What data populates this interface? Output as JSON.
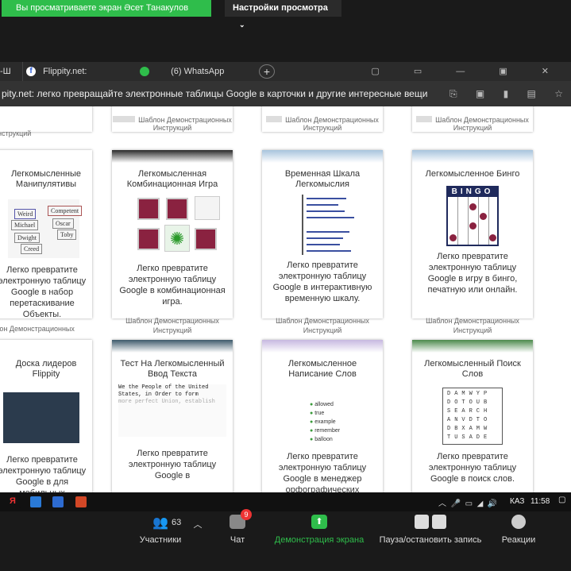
{
  "zoom": {
    "share_banner": "Вы просматриваете экран Әсет Танакулов",
    "view_options": "Настройки просмотра",
    "participants_label": "Участники",
    "participants_count": "63",
    "chat_label": "Чат",
    "chat_badge": "9",
    "share_screen_label": "Демонстрация экрана",
    "pause_record_label": "Пауза/остановить запись",
    "reactions_label": "Реакции"
  },
  "browser": {
    "tabs": [
      {
        "label": "-Ш"
      },
      {
        "label": "Flippity.net: Случайный в"
      },
      {
        "label": "(6) WhatsApp"
      }
    ],
    "new_tab": "+",
    "page_title": "pity.net: легко превращайте электронные таблицы Google в карточки и другие интересные вещи"
  },
  "page": {
    "top_captions": [
      "Шаблон Демонстрационных Инструкций",
      "Шаблон Демонстрационных Инструкций",
      "Шаблон Демонстрационных Инструкций",
      "Шаблон Демонстрационных Инструкций"
    ],
    "row1": [
      {
        "title": "Легкомысленные Манипулятивы",
        "desc": "Легко превратите электронную таблицу Google в набор перетаскивание Объекты.",
        "caption": "Шаблон Демонстрационных"
      },
      {
        "title": "Легкомысленная Комбинационная Игра",
        "desc": "Легко превратите электронную таблицу Google в комбинационная игра.",
        "caption": "Шаблон Демонстрационных Инструкций"
      },
      {
        "title": "Временная Шкала Легкомыслия",
        "desc": "Легко превратите электронную таблицу Google в интерактивную временную шкалу.",
        "caption": "Шаблон Демонстрационных Инструкций"
      },
      {
        "title": "Легкомысленное Бинго",
        "desc": "Легко превратите электронную таблицу Google в игру в бинго, печатную или онлайн.",
        "caption": "Шаблон Демонстрационных Инструкций"
      }
    ],
    "row2": [
      {
        "title": "Доска лидеров Flippity",
        "desc": "Легко превратите электронную таблицу Google в для мобильных"
      },
      {
        "title": "Тест На Легкомысленный Ввод Текста",
        "desc": "Легко превратите электронную таблицу Google в"
      },
      {
        "title": "Легкомысленное Написание Слов",
        "desc": "Легко превратите электронную таблицу Google в менеджер орфографических"
      },
      {
        "title": "Легкомысленный Поиск Слов",
        "desc": "Легко превратите электронную таблицу Google в поиск слов."
      }
    ],
    "manip_words": [
      "Weird",
      "Competent",
      "Michael",
      "Oscar",
      "Dwight",
      "Toby",
      "Creed"
    ],
    "bingo_word": "BINGO",
    "typing_sample": "We the People of the United States, in Order to form",
    "typing_sample2": "more perfect Union, establish",
    "spelling_words": [
      "allowed",
      "true",
      "example",
      "remember",
      "balloon"
    ],
    "wordsearch": [
      [
        "D",
        "A",
        "M",
        "W",
        "Y",
        "P"
      ],
      [
        "D",
        "O",
        "T",
        "O",
        "U",
        "B"
      ],
      [
        "S",
        "E",
        "A",
        "R",
        "C",
        "H"
      ],
      [
        "A",
        "N",
        "V",
        "D",
        "T",
        "O"
      ],
      [
        "D",
        "B",
        "X",
        "A",
        "M",
        "W"
      ],
      [
        "T",
        "U",
        "S",
        "A",
        "D",
        "E"
      ]
    ]
  },
  "taskbar": {
    "lang": "КАЗ",
    "time": "11:58"
  },
  "colors": {
    "share_green": "#2fbd4b",
    "card_strip_dark": "#2a2a2a",
    "bingo_navy": "#1f2a5c"
  }
}
